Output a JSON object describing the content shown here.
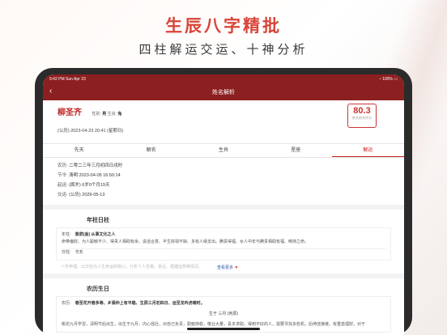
{
  "promo": {
    "title": "生辰八字精批",
    "subtitle": "四柱解运交运、十神分析"
  },
  "status_bar": {
    "time": "9:42 PM Sun Apr 23",
    "battery": "100%"
  },
  "nav": {
    "title": "姓名解析",
    "back_icon": "chevron-left-icon"
  },
  "profile": {
    "name": "柳圣齐",
    "gender_label": "性别:",
    "gender": "男",
    "zodiac_label": "生肖:",
    "zodiac": "兔",
    "date": "(公历) 2023-04-23 20:41 (星期日)",
    "score": "80.3",
    "score_label": "姓名综合评分"
  },
  "tabs": [
    {
      "label": "先天",
      "active": false
    },
    {
      "label": "解名",
      "active": false
    },
    {
      "label": "生肖",
      "active": false
    },
    {
      "label": "星座",
      "active": false
    },
    {
      "label": "解运",
      "active": true
    }
  ],
  "info_rows": [
    {
      "label": "农历:",
      "value": "二零二三年三月初四日戌时"
    },
    {
      "label": "节令:",
      "value": "清明 2023-04-05 16:50:14"
    },
    {
      "label": "起运:",
      "value": "(周岁) 6岁0个月19天"
    },
    {
      "label": "交运:",
      "value": "(公历) 2029-05-13"
    }
  ],
  "year_pillar": {
    "title": "年柱日柱",
    "line1_label": "年柱:",
    "line1_value": "敦牂(金) 从事文化之人",
    "line2": "命带偏财、为人聪敏不少、得贵人相助有余、说话合意、平生财禄不缺、多有人缘支出。腾贵得福、女人中年与腾贵相助有福、倒持之命。",
    "line3_label": "日柱:",
    "line3_value": "辛亥",
    "faded": "八字命理，以日柱为人生命运的核心，分析个人性格、事业、婚姻运势等情况。",
    "more": "查看更多"
  },
  "lunar_birth": {
    "title": "农历生日",
    "line1_label": "农历:",
    "line1_value": "春至花开春多等、乡驿仲上有平稳、生辰三月初四日、运至龙吟虎啸时。",
    "center": "生于 三月 (丙辰)",
    "line2": "桃花九月学習，清明节后出生，出生于九月，内心强壮，对自己负责，勤勉持稳，敬业大量，喜多求助，得到不好的人，需要寻找多些机，后绮佳接继，有重患理财，对于"
  }
}
